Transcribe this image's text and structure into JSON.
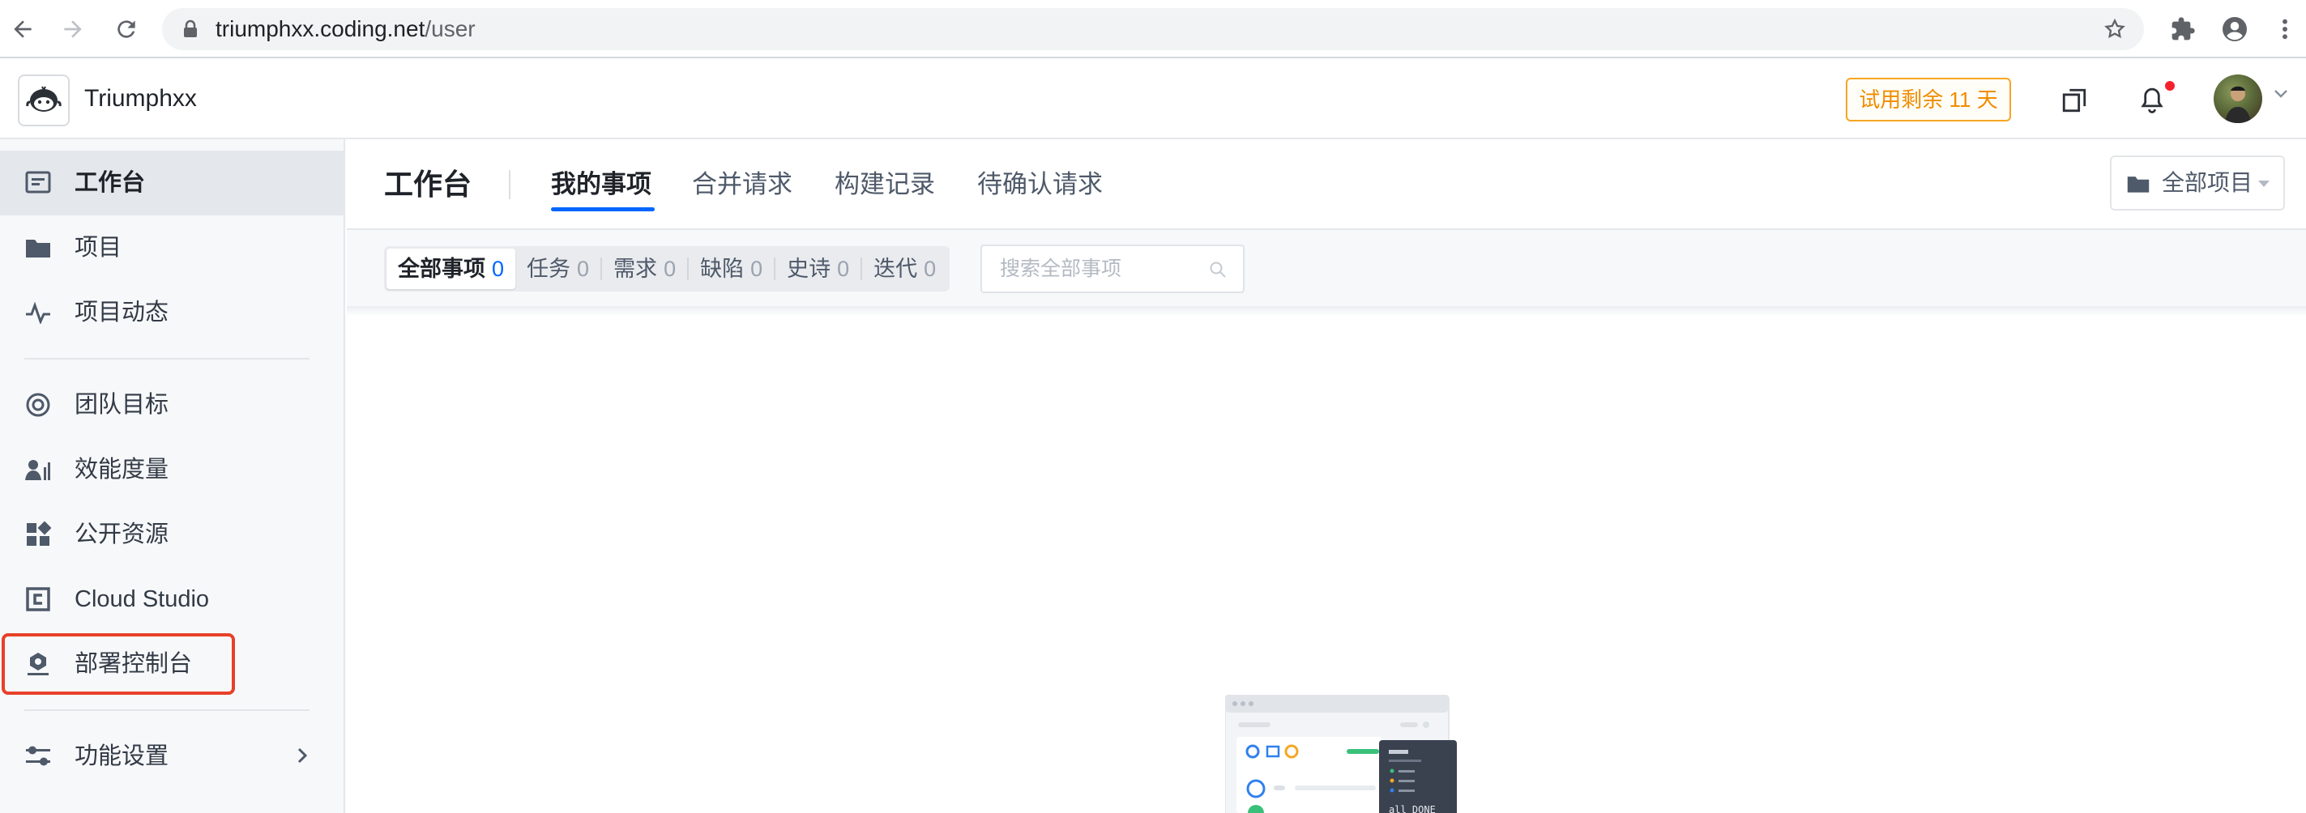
{
  "browser": {
    "url_host": "triumphxx.coding.net",
    "url_path": "/user"
  },
  "header": {
    "team_name": "Triumphxx",
    "trial_badge": "试用剩余 11 天"
  },
  "sidebar": {
    "items": [
      {
        "label": "工作台"
      },
      {
        "label": "项目"
      },
      {
        "label": "项目动态"
      },
      {
        "label": "团队目标"
      },
      {
        "label": "效能度量"
      },
      {
        "label": "公开资源"
      },
      {
        "label": "Cloud Studio"
      },
      {
        "label": "部署控制台"
      },
      {
        "label": "功能设置"
      }
    ]
  },
  "main": {
    "title": "工作台",
    "tabs": [
      {
        "label": "我的事项"
      },
      {
        "label": "合并请求"
      },
      {
        "label": "构建记录"
      },
      {
        "label": "待确认请求"
      }
    ],
    "project_select": "全部项目",
    "filters": [
      {
        "label": "全部事项",
        "count": "0"
      },
      {
        "label": "任务",
        "count": "0"
      },
      {
        "label": "需求",
        "count": "0"
      },
      {
        "label": "缺陷",
        "count": "0"
      },
      {
        "label": "史诗",
        "count": "0"
      },
      {
        "label": "迭代",
        "count": "0"
      }
    ],
    "search_placeholder": "搜索全部事项"
  },
  "illustration": {
    "status_text": "all DONE"
  },
  "colors": {
    "accent": "#0066ff",
    "trial": "#f08c00",
    "highlight": "#e8402a",
    "notification": "#f5222d"
  }
}
